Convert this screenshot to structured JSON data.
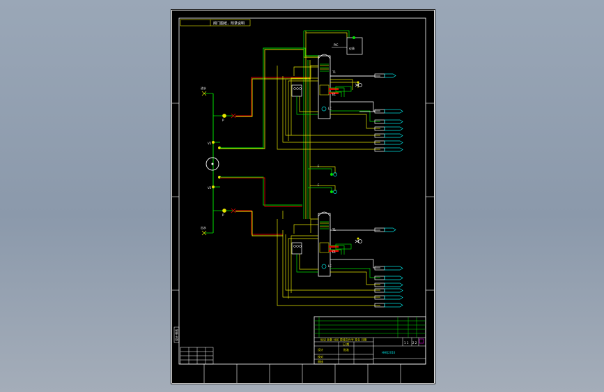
{
  "drawing": {
    "title_note": "阀门图纸，附录说明",
    "side_label": "设计 修改",
    "title_block": {
      "drawing_no": "HHQ2016",
      "scale": "1 1",
      "row_labels": [
        "设计",
        "校对",
        "审核",
        "批准"
      ],
      "row_label_2": "日 期",
      "sheet_mark": "2 2"
    },
    "pumps": {
      "pump_label": "P"
    },
    "colors": {
      "background": "#000000",
      "pipe_yellow": "#e6e600",
      "pipe_green": "#00e000",
      "pipe_red": "#e00000",
      "instrument_cyan": "#00e0e0",
      "frame_white": "#ffffff"
    }
  }
}
